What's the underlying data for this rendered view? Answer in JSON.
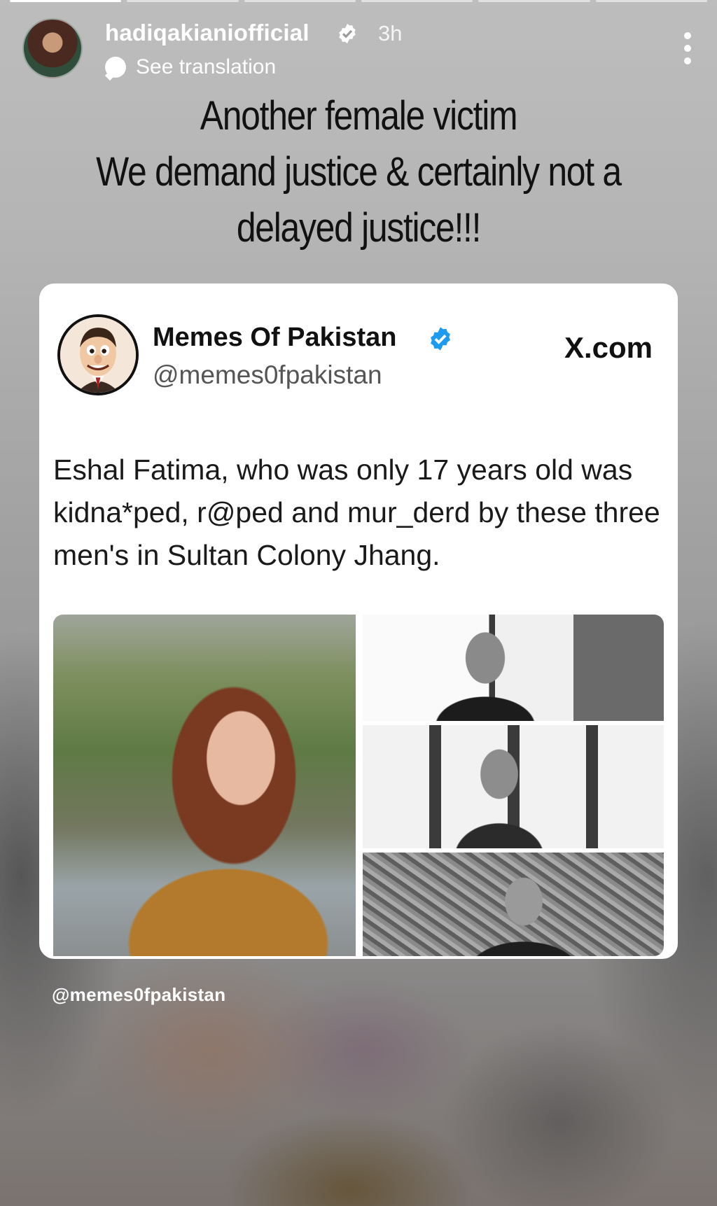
{
  "story": {
    "progress_segments": 6,
    "active_segment": 1,
    "username": "hadiqakianiofficial",
    "time": "3h",
    "translate_label": "See translation",
    "caption_lines": [
      "Another female victim",
      "We demand justice & certainly not a",
      "delayed justice!!!"
    ],
    "watermark": "@memes0fpakistan"
  },
  "tweet": {
    "name": "Memes Of Pakistan",
    "handle": "@memes0fpakistan",
    "source": "X.com",
    "text": "Eshal Fatima, who was only 17 years old was kidna*ped, r@ped and mur_derd by these three men's in Sultan Colony Jhang."
  },
  "colors": {
    "verified_blue": "#1d9bf0",
    "card_bg": "#ffffff",
    "text_primary": "#111111"
  },
  "icons": {
    "verified": "verified-badge-icon",
    "translate": "speech-bubble-icon",
    "more": "more-vertical-icon"
  }
}
